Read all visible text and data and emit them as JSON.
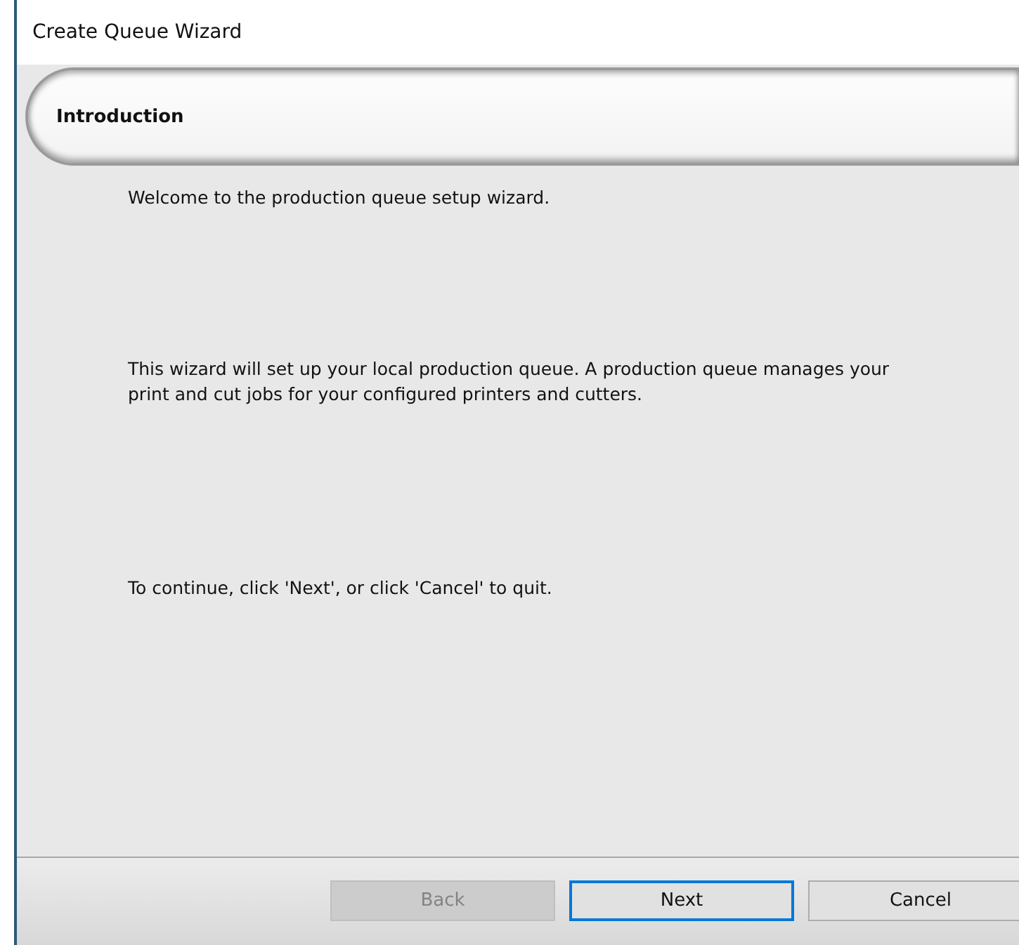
{
  "window": {
    "title": "Create Queue Wizard"
  },
  "header": {
    "title": "Introduction"
  },
  "paragraphs": [
    "Welcome to the production queue setup wizard.",
    "This wizard will set up your local production queue. A production queue manages your print and cut jobs for your configured printers and cutters.",
    "To continue, click 'Next', or click 'Cancel' to quit."
  ],
  "buttons": [
    {
      "label": "Back",
      "disabled": true,
      "default": false
    },
    {
      "label": "Next",
      "disabled": false,
      "default": true
    },
    {
      "label": "Cancel",
      "disabled": false,
      "default": false
    }
  ]
}
